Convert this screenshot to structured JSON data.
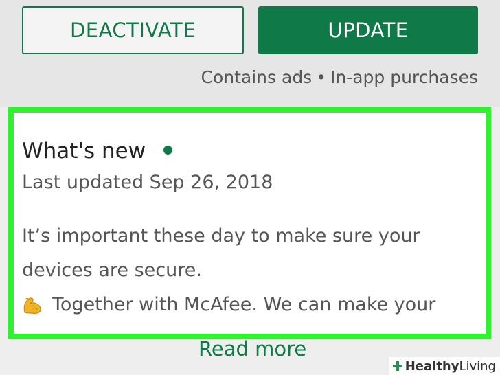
{
  "actions": {
    "deactivate_label": "DEACTIVATE",
    "update_label": "UPDATE"
  },
  "meta": {
    "contains_ads": "Contains ads",
    "separator": "•",
    "in_app": "In-app purchases"
  },
  "whats_new": {
    "title": "What's new",
    "last_updated": "Last updated Sep 26, 2018",
    "lines": [
      "It’s important these day to make sure your",
      "devices are secure.",
      "Together with McAfee. We can make your"
    ],
    "read_more": "Read more"
  },
  "watermark": {
    "bold": "Healthy",
    "light": " Living"
  },
  "colors": {
    "accent_green": "#0f7a47",
    "highlight_border": "#2ef22c"
  },
  "icons": {
    "new_indicator": "green-dot-icon",
    "emoji": "flexed-biceps-icon",
    "watermark": "plus-icon"
  }
}
